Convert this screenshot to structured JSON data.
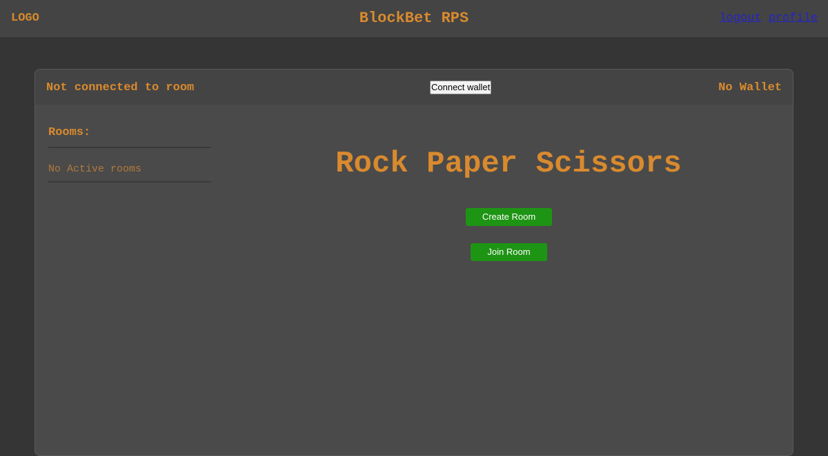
{
  "header": {
    "logo": "LOGO",
    "title": "BlockBet RPS",
    "links": {
      "logout": "logout",
      "profile": "profile"
    }
  },
  "panel": {
    "room_status": "Not connected to room",
    "connect_wallet_label": "Connect wallet",
    "wallet_status": "No Wallet",
    "sidebar": {
      "title": "Rooms:",
      "empty_message": "No Active rooms"
    },
    "main": {
      "title": "Rock Paper Scissors",
      "create_room_label": "Create Room",
      "join_room_label": "Join Room"
    }
  },
  "colors": {
    "accent": "#d98a2e",
    "button_green": "#1e9414",
    "link": "#2424c8",
    "background": "#353535",
    "panel": "#4a4a4a"
  }
}
